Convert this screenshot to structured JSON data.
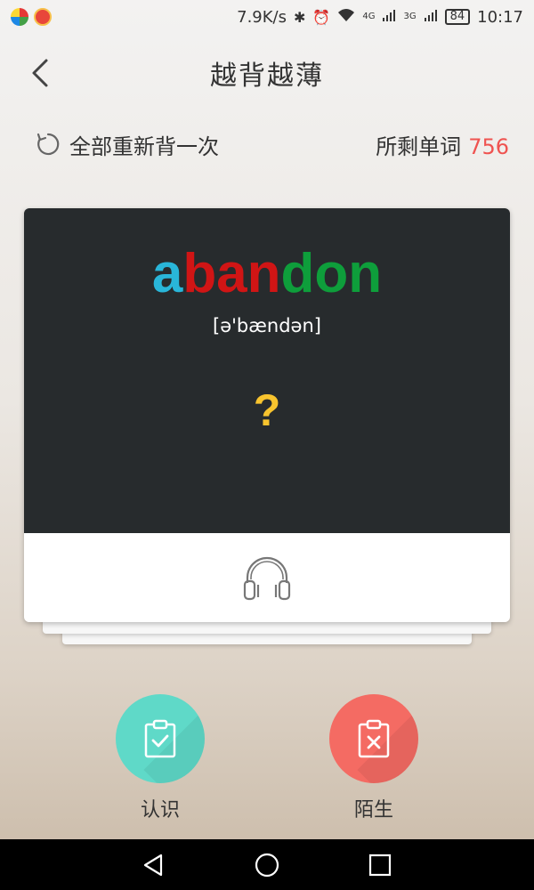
{
  "status_bar": {
    "speed": "7.9K/s",
    "network_a": "4G",
    "network_b": "3G",
    "battery": "84",
    "time": "10:17"
  },
  "header": {
    "title": "越背越薄",
    "back_icon": "chevron-left-icon"
  },
  "subbar": {
    "restart_label": "全部重新背一次",
    "remaining_label": "所剩单词",
    "remaining_count": "756"
  },
  "card": {
    "word_parts": [
      {
        "text": "a",
        "color": "#29b6d9"
      },
      {
        "text": "ban",
        "color": "#d01515"
      },
      {
        "text": "don",
        "color": "#0e9e3b"
      }
    ],
    "phonetic": "[ə'bændən]",
    "hidden_meaning": "?",
    "audio_icon": "headphones-icon"
  },
  "actions": {
    "know_label": "认识",
    "unknown_label": "陌生"
  },
  "colors": {
    "know": "#5fd9c8",
    "unknown": "#f46b63",
    "card_bg": "#272b2d",
    "count": "#ef5350"
  }
}
